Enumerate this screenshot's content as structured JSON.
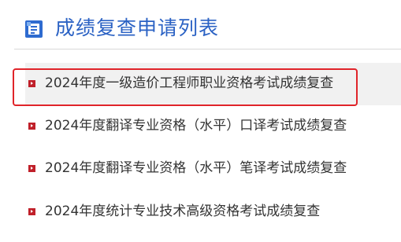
{
  "header": {
    "title": "成绩复查申请列表",
    "icon": "document-list-icon"
  },
  "list": {
    "items": [
      {
        "label": "2024年度一级造价工程师职业资格考试成绩复查",
        "highlighted": true
      },
      {
        "label": "2024年度翻译专业资格（水平）口译考试成绩复查",
        "highlighted": false
      },
      {
        "label": "2024年度翻译专业资格（水平）笔译考试成绩复查",
        "highlighted": false
      },
      {
        "label": "2024年度统计专业技术高级资格考试成绩复查",
        "highlighted": false
      }
    ]
  },
  "colors": {
    "title": "#2b62c4",
    "bullet": "#c0202a",
    "highlight_border": "#e0242a",
    "row_highlight_bg": "#f1f1f1",
    "text": "#333333"
  }
}
